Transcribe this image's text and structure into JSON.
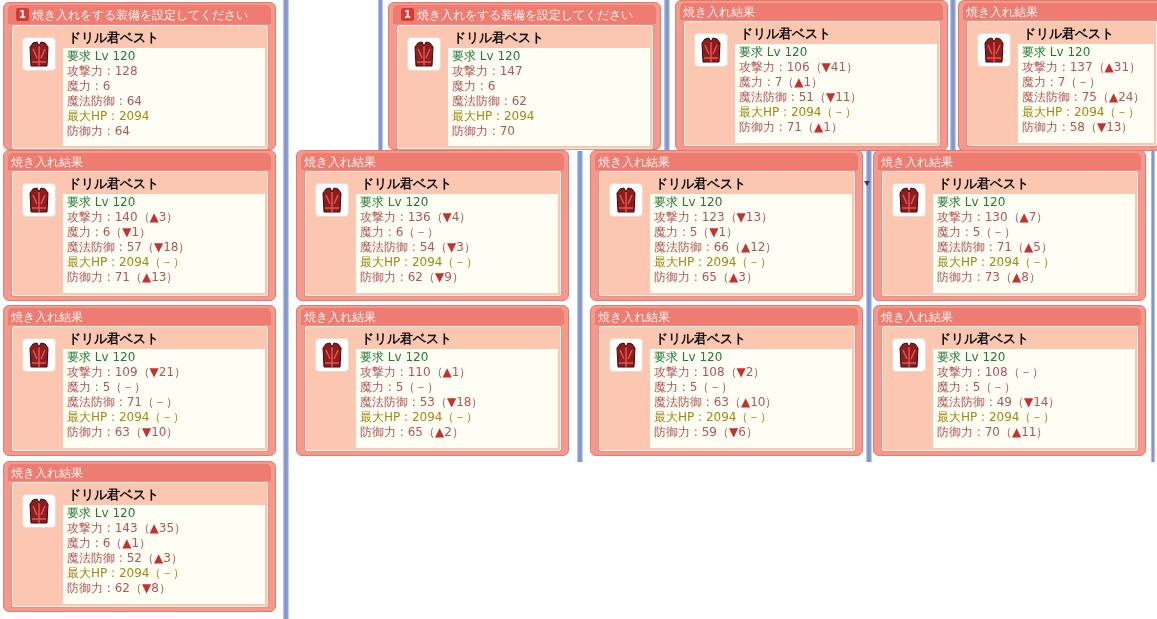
{
  "windows": [
    {
      "kind": "setup",
      "step": "1",
      "title": "焼き入れをする装備を設定してください",
      "item": {
        "name": "ドリル君ベスト",
        "stats": [
          {
            "kind": "requirement",
            "text": "要求 Lv 120"
          },
          {
            "kind": "stat",
            "text": "攻撃力 : 128"
          },
          {
            "kind": "stat",
            "text": "魔力 : 6"
          },
          {
            "kind": "stat",
            "text": "魔法防御 : 64"
          },
          {
            "kind": "hp",
            "text": "最大HP : 2094"
          },
          {
            "kind": "stat",
            "text": "防御力 : 64"
          }
        ]
      }
    },
    {
      "kind": "setup",
      "step": "1",
      "title": "焼き入れをする装備を設定してください",
      "item": {
        "name": "ドリル君ベスト",
        "stats": [
          {
            "kind": "requirement",
            "text": "要求 Lv 120"
          },
          {
            "kind": "stat",
            "text": "攻撃力 : 147"
          },
          {
            "kind": "stat",
            "text": "魔力 : 6"
          },
          {
            "kind": "stat",
            "text": "魔法防御 : 62"
          },
          {
            "kind": "hp",
            "text": "最大HP : 2094"
          },
          {
            "kind": "stat",
            "text": "防御力 : 70"
          }
        ]
      }
    },
    {
      "kind": "result",
      "title": "焼き入れ結果",
      "item": {
        "name": "ドリル君ベスト",
        "stats": [
          {
            "kind": "requirement",
            "text": "要求 Lv 120"
          },
          {
            "kind": "stat",
            "text": "攻撃力 : 106（",
            "arrow": "▼",
            "rest": "41）"
          },
          {
            "kind": "stat",
            "text": "魔力 : 7（",
            "arrow": "▲",
            "rest": "1）"
          },
          {
            "kind": "stat",
            "text": "魔法防御 : 51（",
            "arrow": "▼",
            "rest": "11）"
          },
          {
            "kind": "hp",
            "text": "最大HP : 2094（－）"
          },
          {
            "kind": "stat",
            "text": "防御力 : 71（",
            "arrow": "▲",
            "rest": "1）"
          }
        ]
      }
    },
    {
      "kind": "result",
      "title": "焼き入れ結果",
      "item": {
        "name": "ドリル君ベスト",
        "stats": [
          {
            "kind": "requirement",
            "text": "要求 Lv 120"
          },
          {
            "kind": "stat",
            "text": "攻撃力 : 137（",
            "arrow": "▲",
            "rest": "31）"
          },
          {
            "kind": "stat",
            "text": "魔力 : 7（－）"
          },
          {
            "kind": "stat",
            "text": "魔法防御 : 75（",
            "arrow": "▲",
            "rest": "24）"
          },
          {
            "kind": "hp",
            "text": "最大HP : 2094（－）"
          },
          {
            "kind": "stat",
            "text": "防御力 : 58（",
            "arrow": "▼",
            "rest": "13）"
          }
        ]
      }
    },
    {
      "kind": "result",
      "title": "焼き入れ結果",
      "item": {
        "name": "ドリル君ベスト",
        "stats": [
          {
            "kind": "requirement",
            "text": "要求 Lv 120"
          },
          {
            "kind": "stat",
            "text": "攻撃力 : 140（",
            "arrow": "▲",
            "rest": "3）"
          },
          {
            "kind": "stat",
            "text": "魔力 : 6（",
            "arrow": "▼",
            "rest": "1）"
          },
          {
            "kind": "stat",
            "text": "魔法防御 : 57（",
            "arrow": "▼",
            "rest": "18）"
          },
          {
            "kind": "hp",
            "text": "最大HP : 2094（－）"
          },
          {
            "kind": "stat",
            "text": "防御力 : 71（",
            "arrow": "▲",
            "rest": "13）"
          }
        ]
      }
    },
    {
      "kind": "result",
      "title": "焼き入れ結果",
      "item": {
        "name": "ドリル君ベスト",
        "stats": [
          {
            "kind": "requirement",
            "text": "要求 Lv 120"
          },
          {
            "kind": "stat",
            "text": "攻撃力 : 136（",
            "arrow": "▼",
            "rest": "4）"
          },
          {
            "kind": "stat",
            "text": "魔力 : 6（－）"
          },
          {
            "kind": "stat",
            "text": "魔法防御 : 54（",
            "arrow": "▼",
            "rest": "3）"
          },
          {
            "kind": "hp",
            "text": "最大HP : 2094（－）"
          },
          {
            "kind": "stat",
            "text": "防御力 : 62（",
            "arrow": "▼",
            "rest": "9）"
          }
        ]
      }
    },
    {
      "kind": "result",
      "title": "焼き入れ結果",
      "item": {
        "name": "ドリル君ベスト",
        "stats": [
          {
            "kind": "requirement",
            "text": "要求 Lv 120"
          },
          {
            "kind": "stat",
            "text": "攻撃力 : 123（",
            "arrow": "▼",
            "rest": "13）"
          },
          {
            "kind": "stat",
            "text": "魔力 : 5（",
            "arrow": "▼",
            "rest": "1）"
          },
          {
            "kind": "stat",
            "text": "魔法防御 : 66（",
            "arrow": "▲",
            "rest": "12）"
          },
          {
            "kind": "hp",
            "text": "最大HP : 2094（－）"
          },
          {
            "kind": "stat",
            "text": "防御力 : 65（",
            "arrow": "▲",
            "rest": "3）"
          }
        ]
      }
    },
    {
      "kind": "result",
      "title": "焼き入れ結果",
      "item": {
        "name": "ドリル君ベスト",
        "stats": [
          {
            "kind": "requirement",
            "text": "要求 Lv 120"
          },
          {
            "kind": "stat",
            "text": "攻撃力 : 130（",
            "arrow": "▲",
            "rest": "7）"
          },
          {
            "kind": "stat",
            "text": "魔力 : 5（－）"
          },
          {
            "kind": "stat",
            "text": "魔法防御 : 71（",
            "arrow": "▲",
            "rest": "5）"
          },
          {
            "kind": "hp",
            "text": "最大HP : 2094（－）"
          },
          {
            "kind": "stat",
            "text": "防御力 : 73（",
            "arrow": "▲",
            "rest": "8）"
          }
        ]
      }
    },
    {
      "kind": "result",
      "title": "焼き入れ結果",
      "item": {
        "name": "ドリル君ベスト",
        "stats": [
          {
            "kind": "requirement",
            "text": "要求 Lv 120"
          },
          {
            "kind": "stat",
            "text": "攻撃力 : 109（",
            "arrow": "▼",
            "rest": "21）"
          },
          {
            "kind": "stat",
            "text": "魔力 : 5（－）"
          },
          {
            "kind": "stat",
            "text": "魔法防御 : 71（－）"
          },
          {
            "kind": "hp",
            "text": "最大HP : 2094（－）"
          },
          {
            "kind": "stat",
            "text": "防御力 : 63（",
            "arrow": "▼",
            "rest": "10）"
          }
        ]
      }
    },
    {
      "kind": "result",
      "title": "焼き入れ結果",
      "item": {
        "name": "ドリル君ベスト",
        "stats": [
          {
            "kind": "requirement",
            "text": "要求 Lv 120"
          },
          {
            "kind": "stat",
            "text": "攻撃力 : 110（",
            "arrow": "▲",
            "rest": "1）"
          },
          {
            "kind": "stat",
            "text": "魔力 : 5（－）"
          },
          {
            "kind": "stat",
            "text": "魔法防御 : 53（",
            "arrow": "▼",
            "rest": "18）"
          },
          {
            "kind": "hp",
            "text": "最大HP : 2094（－）"
          },
          {
            "kind": "stat",
            "text": "防御力 : 65（",
            "arrow": "▲",
            "rest": "2）"
          }
        ]
      }
    },
    {
      "kind": "result",
      "title": "焼き入れ結果",
      "item": {
        "name": "ドリル君ベスト",
        "stats": [
          {
            "kind": "requirement",
            "text": "要求 Lv 120"
          },
          {
            "kind": "stat",
            "text": "攻撃力 : 108（",
            "arrow": "▼",
            "rest": "2）"
          },
          {
            "kind": "stat",
            "text": "魔力 : 5（－）"
          },
          {
            "kind": "stat",
            "text": "魔法防御 : 63（",
            "arrow": "▲",
            "rest": "10）"
          },
          {
            "kind": "hp",
            "text": "最大HP : 2094（－）"
          },
          {
            "kind": "stat",
            "text": "防御力 : 59（",
            "arrow": "▼",
            "rest": "6）"
          }
        ]
      }
    },
    {
      "kind": "result",
      "title": "焼き入れ結果",
      "item": {
        "name": "ドリル君ベスト",
        "stats": [
          {
            "kind": "requirement",
            "text": "要求 Lv 120"
          },
          {
            "kind": "stat",
            "text": "攻撃力 : 108（－）"
          },
          {
            "kind": "stat",
            "text": "魔力 : 5（－）"
          },
          {
            "kind": "stat",
            "text": "魔法防御 : 49（",
            "arrow": "▼",
            "rest": "14）"
          },
          {
            "kind": "hp",
            "text": "最大HP : 2094（－）"
          },
          {
            "kind": "stat",
            "text": "防御力 : 70（",
            "arrow": "▲",
            "rest": "11）"
          }
        ]
      }
    },
    {
      "kind": "result",
      "title": "焼き入れ結果",
      "item": {
        "name": "ドリル君ベスト",
        "stats": [
          {
            "kind": "requirement",
            "text": "要求 Lv 120"
          },
          {
            "kind": "stat",
            "text": "攻撃力 : 143（",
            "arrow": "▲",
            "rest": "35）"
          },
          {
            "kind": "stat",
            "text": "魔力 : 6（",
            "arrow": "▲",
            "rest": "1）"
          },
          {
            "kind": "stat",
            "text": "魔法防御 : 52（",
            "arrow": "▲",
            "rest": "3）"
          },
          {
            "kind": "hp",
            "text": "最大HP : 2094（－）"
          },
          {
            "kind": "stat",
            "text": "防御力 : 62（",
            "arrow": "▼",
            "rest": "8）"
          }
        ]
      }
    }
  ]
}
